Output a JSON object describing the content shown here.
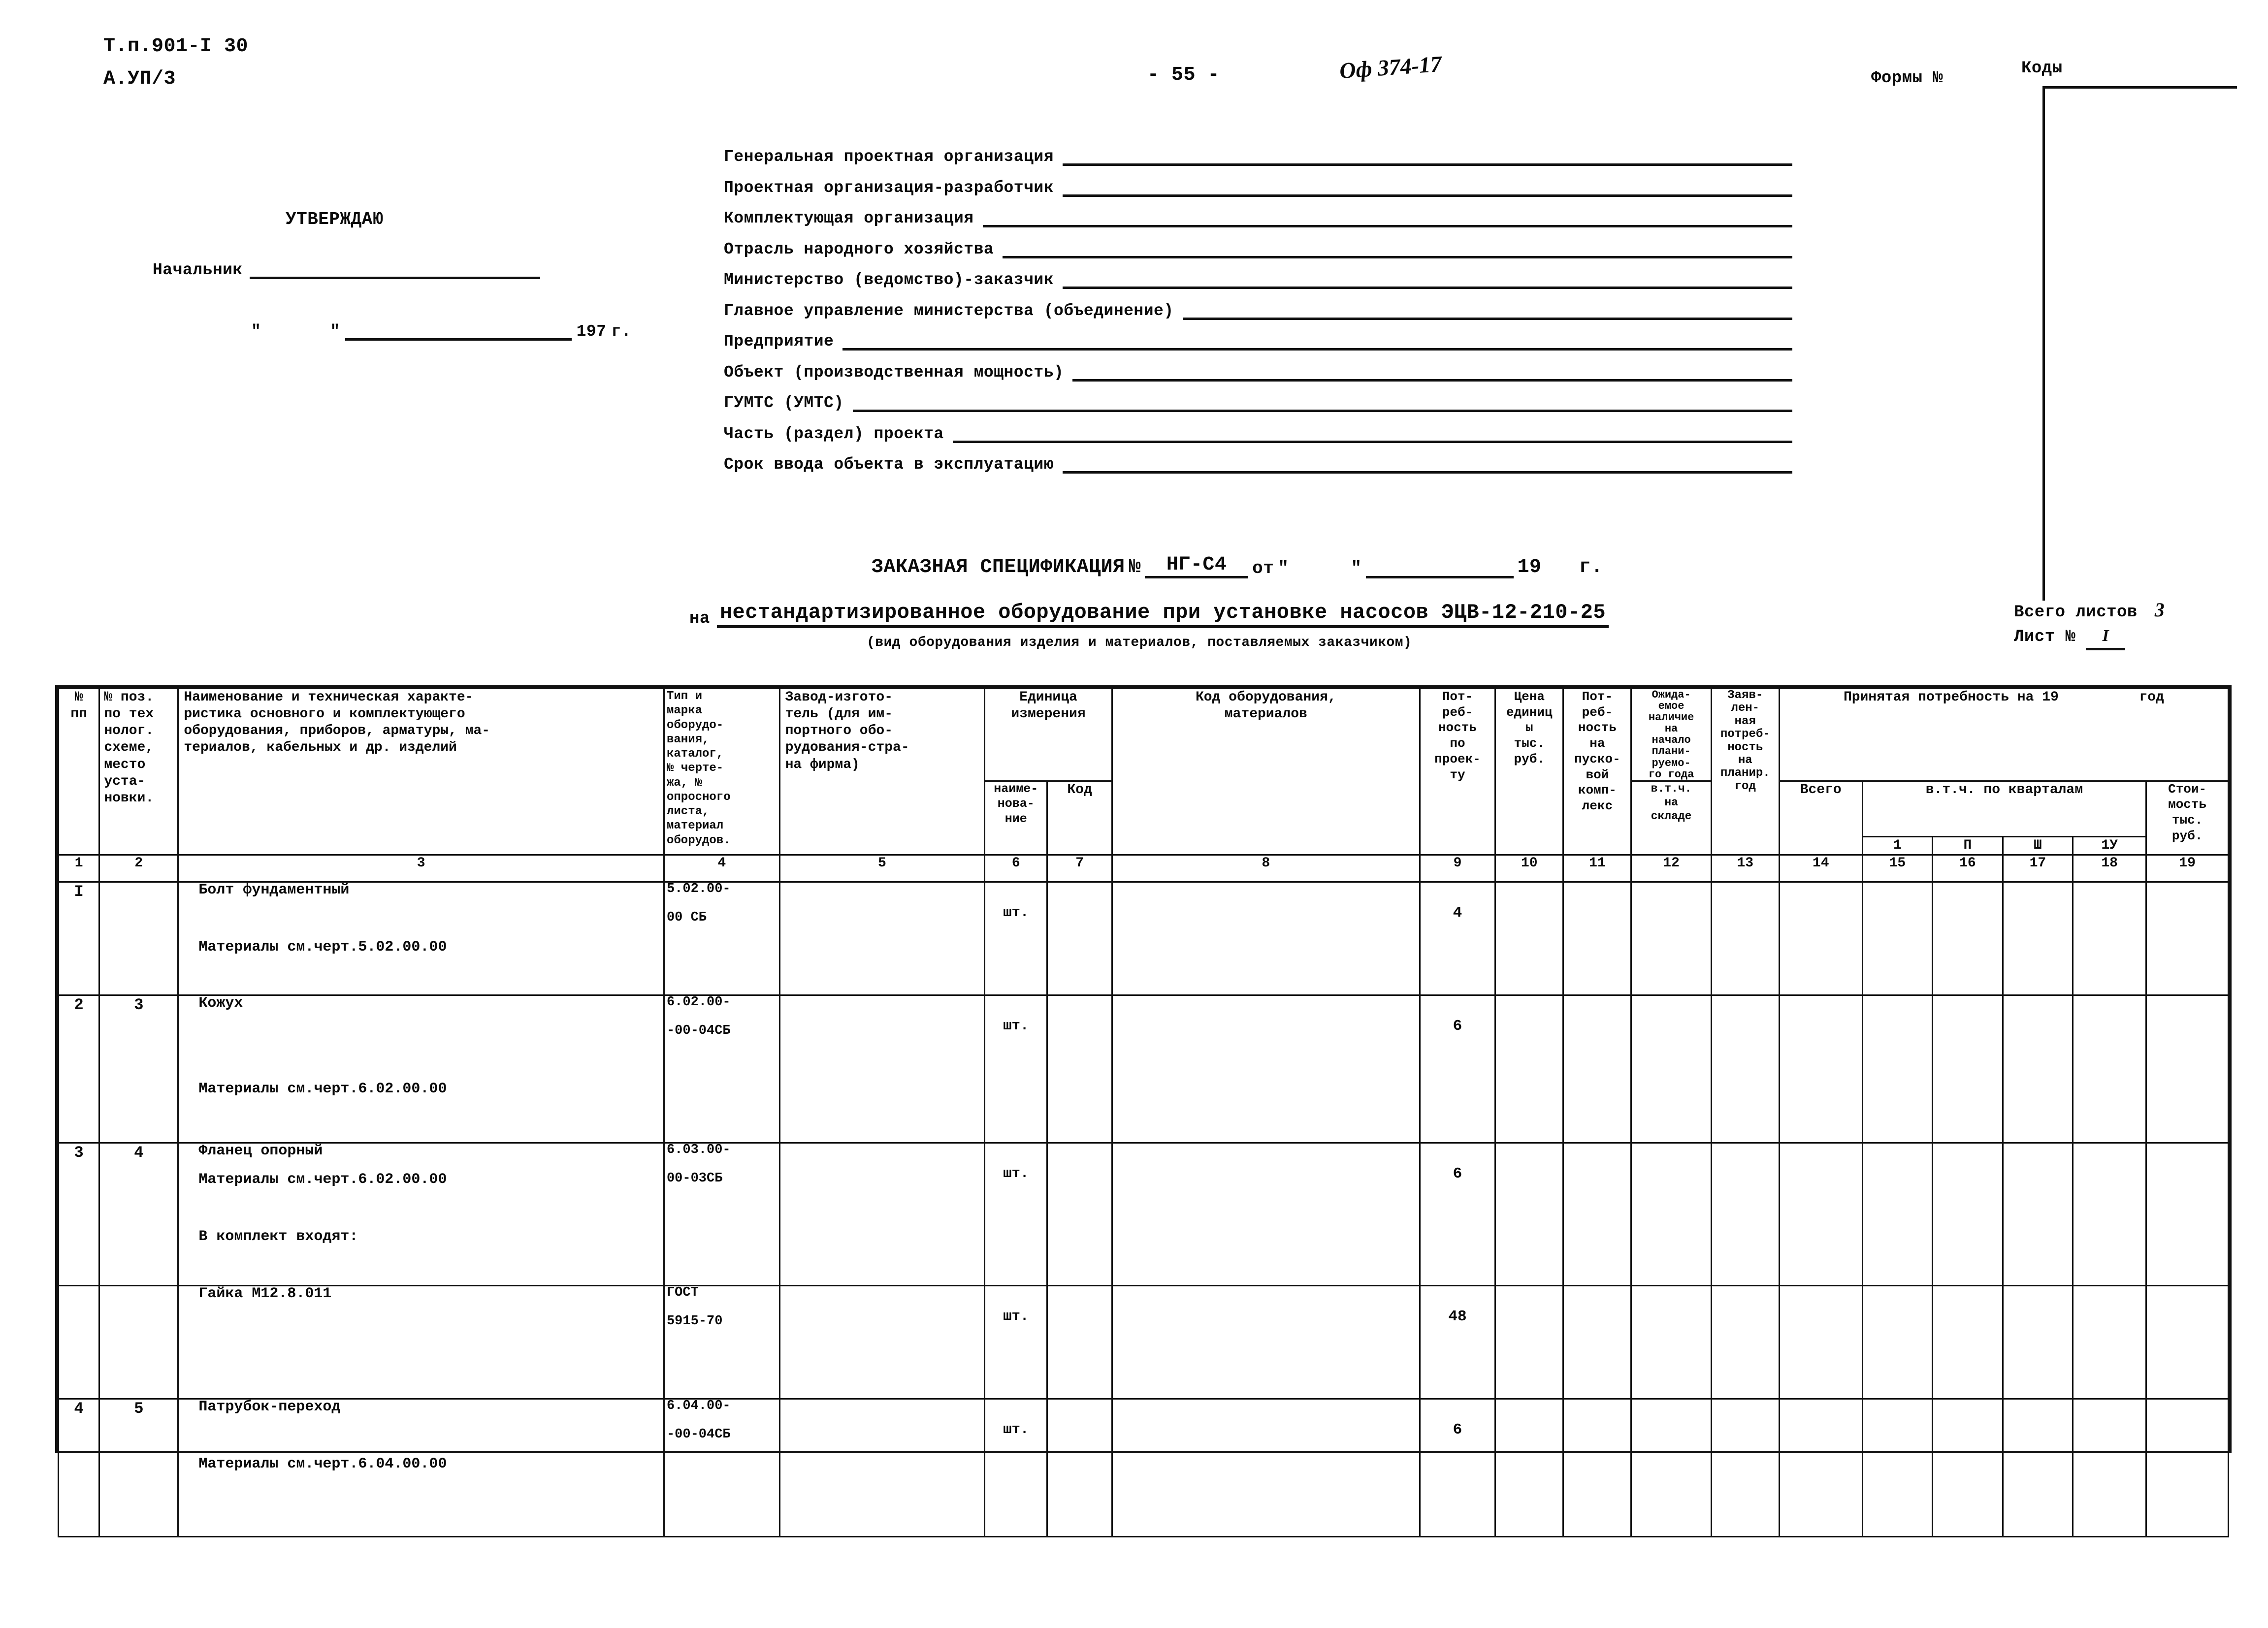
{
  "header": {
    "doc_code_line1": "Т.п.901-I 30",
    "doc_code_line2": "А.УП/3",
    "page_number": "- 55 -",
    "handwritten_note": "Оф 374-17",
    "form_no_label": "Формы №",
    "codes_label": "Коды"
  },
  "approval": {
    "title": "УТВЕРЖДАЮ",
    "chief_label": "Начальник",
    "date_quote_open": "\"",
    "date_quote_close": "\"",
    "year_prefix": "197",
    "year_suffix": "г."
  },
  "fields": [
    "Генеральная проектная организация",
    "Проектная организация-разработчик",
    "Комплектующая организация",
    "Отрасль народного хозяйства",
    "Министерство (ведомство)-заказчик",
    "Главное управление министерства (объединение)",
    "Предприятие",
    "Объект (производственная мощность)",
    "ГУМТС (УМТС)",
    "Часть (раздел) проекта",
    "Срок ввода объекта в эксплуатацию"
  ],
  "spec": {
    "title": "ЗАКАЗНАЯ СПЕЦИФИКАЦИЯ",
    "number_sign": "№",
    "number": "НГ-С4",
    "from_label": "от",
    "quote_open": "\"",
    "quote_close": "\"",
    "year_prefix": "19",
    "year_suffix": "г.",
    "subject_prefix": "на",
    "subject": "нестандартизированное оборудование при установке насосов ЭЦВ-12-210-25",
    "subject_caption": "(вид оборудования изделия и материалов, поставляемых заказчиком)",
    "total_sheets_label": "Всего листов",
    "total_sheets": "3",
    "sheet_label": "Лист №",
    "sheet_no": "I"
  },
  "table": {
    "headers": {
      "c1": "№\nпп",
      "c2": "№ поз.\nпо тех\nнолог.\nсхеме,\nместо\nуста-\nновки.",
      "c3": "Наименование и техническая характе-\nристика основного и комплектующего\nоборудования, приборов, арматуры, ма-\nтериалов, кабельных и др. изделий",
      "c4": "Тип и\nмарка\nоборудо-\nвания,\nкаталог,\n№ черте-\nжа, №\nопросного\nлиста,\nматериал\nоборудов.",
      "c5": "Завод-изгото-\nтель (для им-\nпортного обо-\nрудования-стра-\nна фирма)",
      "c6_7_group": "Единица\nизмерения",
      "c6": "наиме-\nнова-\nние",
      "c7": "Код",
      "c8": "Код оборудования,\nматериалов",
      "c9": "Пот-\nреб-\nность\nпо\nпроек-\nту",
      "c10": "Цена\nединиц\nы\nтыс.\nруб.",
      "c11": "Пот-\nреб-\nность\nна\nпуско-\nвой\nкомп-\nлекс",
      "c12a": "Ожида-\nемое\nналичие\nна\nначало\nплани-\nруемо-\nго года",
      "c12b": "в.т.ч.\nна\nскладе",
      "c13": "Заяв-\nлен-\nная\nпотреб-\nность\nна\nпланир.\nгод",
      "c14_19_group": "Принятая потребность на 19",
      "c14_19_group_suffix": "год",
      "c14": "Всего",
      "quarters_group": "в.т.ч. по кварталам",
      "q1": "1",
      "q2": "П",
      "q3": "Ш",
      "q4": "1У",
      "c19": "Стои-\nмость\nтыс.\nруб."
    },
    "column_numbers": [
      "1",
      "2",
      "3",
      "4",
      "5",
      "6",
      "7",
      "8",
      "9",
      "10",
      "11",
      "12",
      "13",
      "14",
      "15",
      "16",
      "17",
      "18",
      "19"
    ],
    "rows": [
      {
        "num": "I",
        "pos": "",
        "name_lines": [
          "Болт фундаментный",
          "",
          "Материалы см.черт.5.02.00.00"
        ],
        "type_lines": [
          "5.02.00-",
          "00 СБ"
        ],
        "manufacturer": "",
        "unit": "шт.",
        "unit_code": "",
        "equipment_code": "",
        "need_project": "4",
        "unit_price": "",
        "need_startup": "",
        "expected_stock": "",
        "declared_need": "",
        "accepted_total": "",
        "q1": "",
        "q2": "",
        "q3": "",
        "q4": "",
        "cost": ""
      },
      {
        "num": "2",
        "pos": "3",
        "name_lines": [
          "Кожух",
          "",
          "",
          "Материалы см.черт.6.02.00.00"
        ],
        "type_lines": [
          "6.02.00-",
          "-00-04СБ"
        ],
        "manufacturer": "",
        "unit": "шт.",
        "unit_code": "",
        "equipment_code": "",
        "need_project": "6",
        "unit_price": "",
        "need_startup": "",
        "expected_stock": "",
        "declared_need": "",
        "accepted_total": "",
        "q1": "",
        "q2": "",
        "q3": "",
        "q4": "",
        "cost": ""
      },
      {
        "num": "3",
        "pos": "4",
        "name_lines": [
          "Фланец опорный",
          "Материалы см.черт.6.02.00.00",
          "",
          "В комплект входят:"
        ],
        "type_lines": [
          "6.03.00-",
          "00-03СБ"
        ],
        "manufacturer": "",
        "unit": "шт.",
        "unit_code": "",
        "equipment_code": "",
        "need_project": "6",
        "unit_price": "",
        "need_startup": "",
        "expected_stock": "",
        "declared_need": "",
        "accepted_total": "",
        "q1": "",
        "q2": "",
        "q3": "",
        "q4": "",
        "cost": ""
      },
      {
        "num": "",
        "pos": "",
        "name_lines": [
          "Гайка М12.8.011"
        ],
        "type_lines": [
          "ГОСТ",
          "5915-70"
        ],
        "manufacturer": "",
        "unit": "шт.",
        "unit_code": "",
        "equipment_code": "",
        "need_project": "48",
        "unit_price": "",
        "need_startup": "",
        "expected_stock": "",
        "declared_need": "",
        "accepted_total": "",
        "q1": "",
        "q2": "",
        "q3": "",
        "q4": "",
        "cost": ""
      },
      {
        "num": "4",
        "pos": "5",
        "name_lines": [
          "Патрубок-переход",
          "",
          "Материалы см.черт.6.04.00.00"
        ],
        "type_lines": [
          "6.04.00-",
          "-00-04СБ"
        ],
        "manufacturer": "",
        "unit": "шт.",
        "unit_code": "",
        "equipment_code": "",
        "need_project": "6",
        "unit_price": "",
        "need_startup": "",
        "expected_stock": "",
        "declared_need": "",
        "accepted_total": "",
        "q1": "",
        "q2": "",
        "q3": "",
        "q4": "",
        "cost": ""
      }
    ]
  }
}
